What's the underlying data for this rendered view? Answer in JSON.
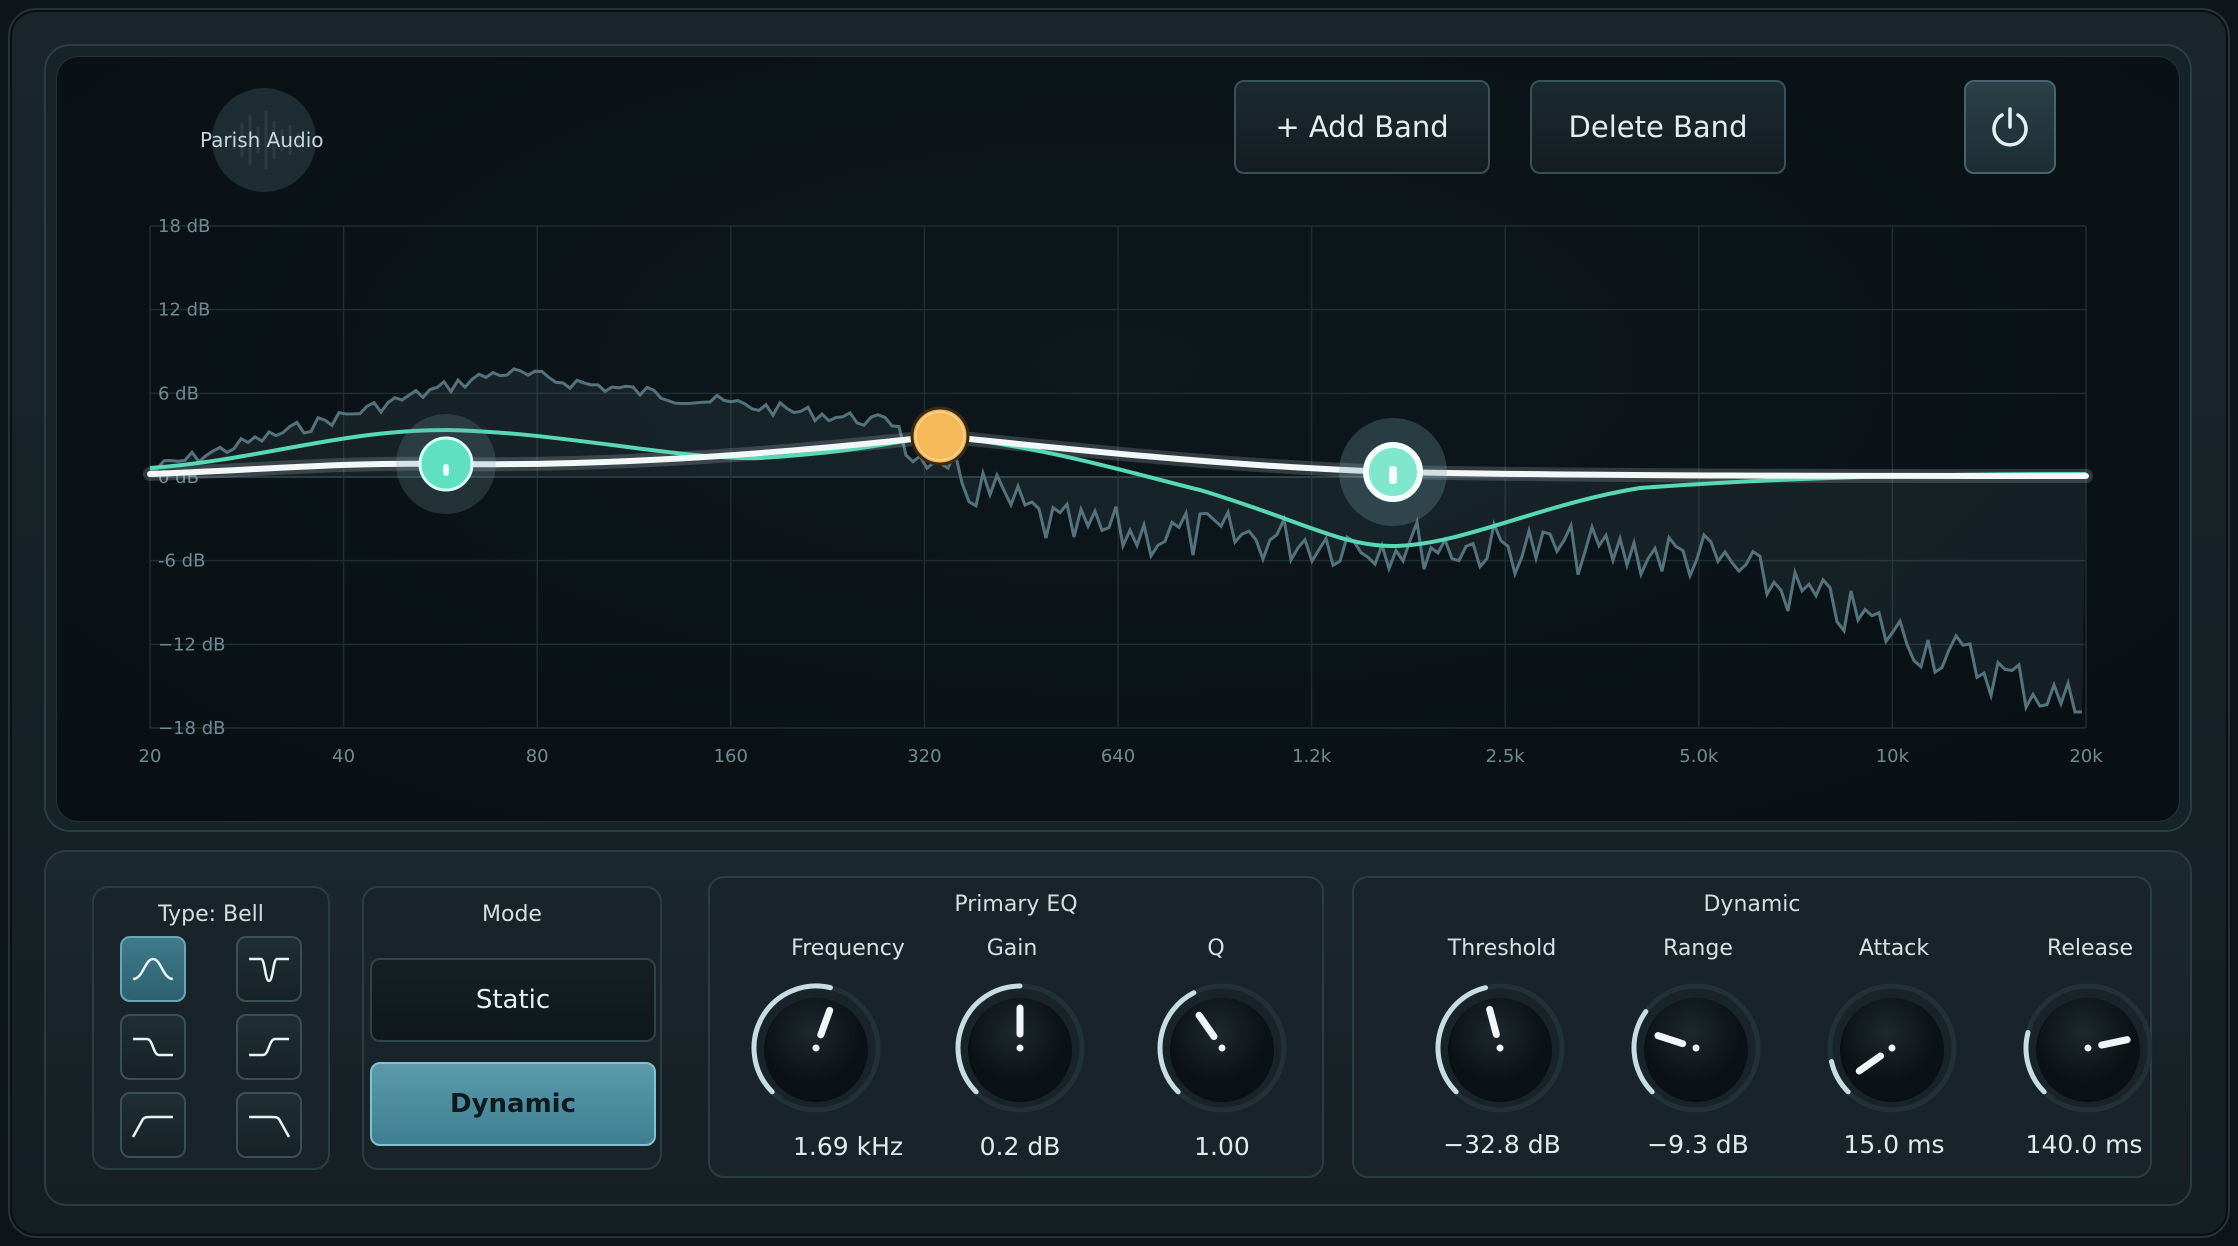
{
  "brand": {
    "name": "Parish Audio"
  },
  "toolbar": {
    "add_band": "+ Add Band",
    "delete_band": "Delete Band",
    "power_icon": "power-icon"
  },
  "graph": {
    "db_labels": [
      "18 dB",
      "12 dB",
      "6 dB",
      "0 dB",
      "-6 dB",
      "−12 dB",
      "−18 dB"
    ],
    "freq_labels": [
      "20",
      "40",
      "80",
      "160",
      "320",
      "640",
      "1.2k",
      "2.5k",
      "5.0k",
      "10k",
      "20k"
    ],
    "bands": [
      {
        "name": "band-1",
        "color": "#5fe0bf"
      },
      {
        "name": "band-2",
        "color": "#f6b95a"
      },
      {
        "name": "band-3",
        "color": "#7ee7cc"
      }
    ],
    "colors": {
      "curve": "#f2f7f8",
      "dynamic_curve": "#58d9b6",
      "spectrum": "#5b7d88"
    }
  },
  "type_section": {
    "title": "Type: Bell",
    "buttons": [
      "bell-icon",
      "notch-icon",
      "low-shelf-icon",
      "high-shelf-icon",
      "high-pass-icon",
      "low-pass-icon"
    ]
  },
  "mode_section": {
    "title": "Mode",
    "static": "Static",
    "dynamic": "Dynamic"
  },
  "primary_eq": {
    "title": "Primary EQ",
    "knobs": [
      {
        "label": "Frequency",
        "value": "1.69 kHz"
      },
      {
        "label": "Gain",
        "value": "0.2 dB"
      },
      {
        "label": "Q",
        "value": "1.00"
      }
    ]
  },
  "dynamic_section": {
    "title": "Dynamic",
    "knobs": [
      {
        "label": "Threshold",
        "value": "−32.8 dB"
      },
      {
        "label": "Range",
        "value": "−9.3 dB"
      },
      {
        "label": "Attack",
        "value": "15.0 ms"
      },
      {
        "label": "Release",
        "value": "140.0 ms"
      }
    ]
  },
  "accent": "#6ad8bd"
}
